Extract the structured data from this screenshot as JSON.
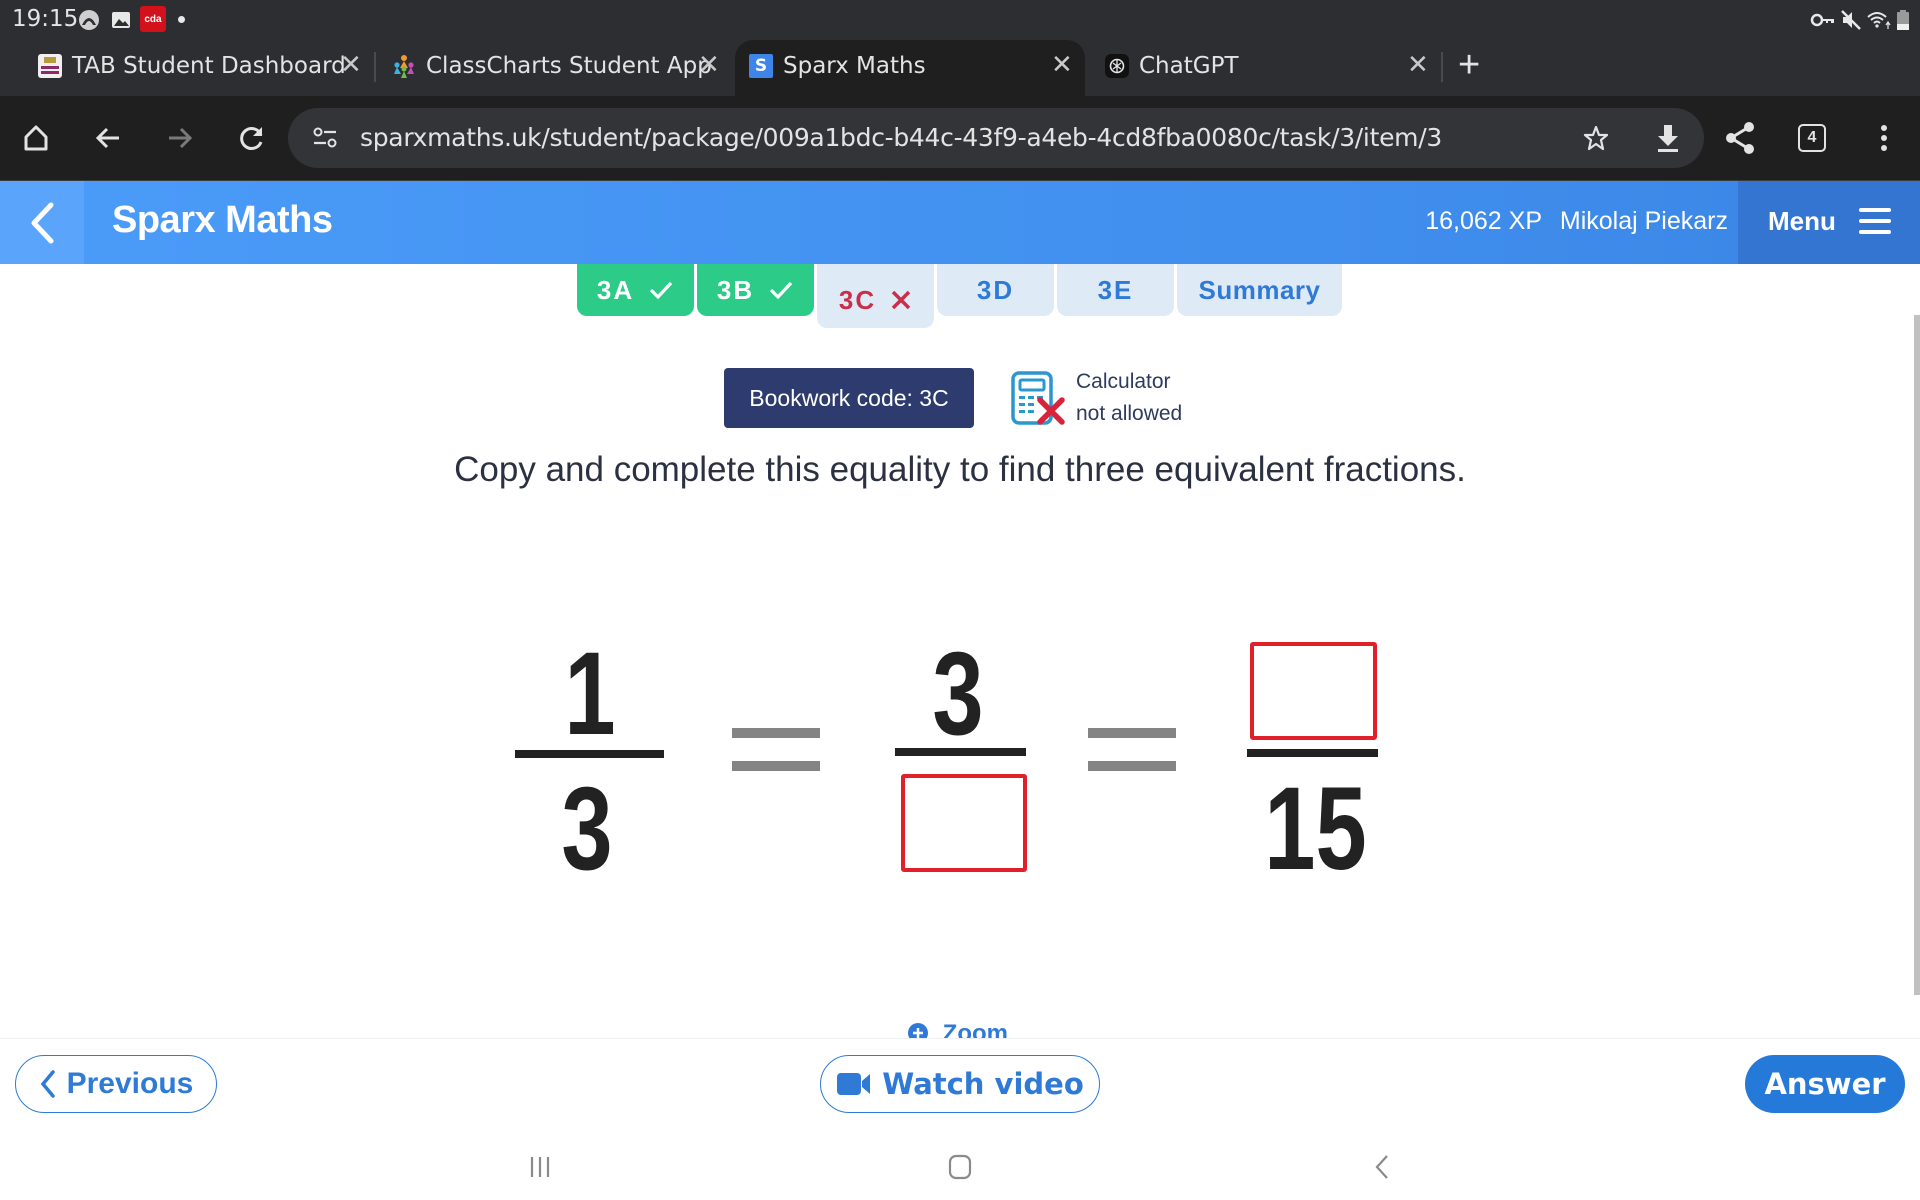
{
  "status_bar": {
    "time": "19:15",
    "left_icons": [
      "vpn-arch-icon",
      "gallery-icon",
      "cda-app-icon",
      "notification-dot-icon"
    ],
    "cda_label": "cda",
    "right_icons": [
      "vpn-key-icon",
      "mute-icon",
      "wifi-icon",
      "battery-icon"
    ]
  },
  "browser": {
    "tabs": [
      {
        "label": "TAB Student Dashboard",
        "active": false,
        "favicon": "tab-dashboard-favicon"
      },
      {
        "label": "ClassCharts Student App",
        "active": false,
        "favicon": "classcharts-favicon"
      },
      {
        "label": "Sparx Maths",
        "active": true,
        "favicon": "sparx-favicon",
        "favicon_letter": "S"
      },
      {
        "label": "ChatGPT",
        "active": false,
        "favicon": "chatgpt-favicon"
      }
    ],
    "close_glyph": "✕",
    "new_tab_glyph": "+",
    "url": "sparxmaths.uk/student/package/009a1bdc-b44c-43f9-a4eb-4cd8fba0080c/task/3/item/3",
    "tab_count": "4"
  },
  "header": {
    "title": "Sparx Maths",
    "xp": "16,062 XP",
    "user": "Mikolaj Piekarz",
    "menu_label": "Menu"
  },
  "task_tabs": [
    {
      "label": "3A",
      "status": "done",
      "mark": "✓"
    },
    {
      "label": "3B",
      "status": "done",
      "mark": "✓"
    },
    {
      "label": "3C",
      "status": "wrong",
      "mark": "✕"
    },
    {
      "label": "3D",
      "status": "pending",
      "mark": ""
    },
    {
      "label": "3E",
      "status": "pending",
      "mark": ""
    },
    {
      "label": "Summary",
      "status": "pending",
      "mark": ""
    }
  ],
  "question": {
    "bookwork_code": "Bookwork code: 3C",
    "calculator_line1": "Calculator",
    "calculator_line2": "not allowed",
    "prompt": "Copy and complete this equality to find three equivalent fractions.",
    "fractions": [
      {
        "numerator": "1",
        "denominator": "3"
      },
      {
        "numerator": "3",
        "denominator": null
      },
      {
        "numerator": null,
        "denominator": "15"
      }
    ],
    "equals_sign": "="
  },
  "footer": {
    "zoom_label": "Zoom",
    "previous_label": "Previous",
    "watch_video_label": "Watch video",
    "answer_label": "Answer"
  },
  "colors": {
    "header_blue": "#4190ef",
    "done_green": "#2ccb88",
    "wrong_red": "#cc2e4a",
    "pending_blue_text": "#2f7ad6",
    "bookwork_navy": "#2e3b6e",
    "answer_box_red": "#e0202b",
    "answer_button_blue": "#2479d9"
  }
}
